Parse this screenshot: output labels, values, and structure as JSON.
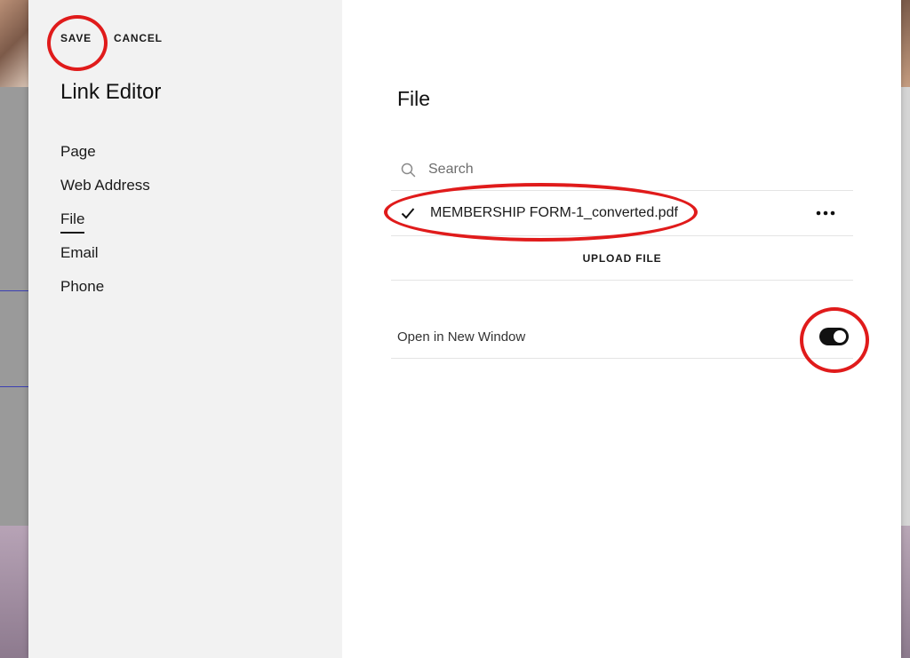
{
  "header": {
    "save_label": "SAVE",
    "cancel_label": "CANCEL",
    "title": "Link Editor"
  },
  "sidebar": {
    "items": [
      {
        "label": "Page"
      },
      {
        "label": "Web Address"
      },
      {
        "label": "File"
      },
      {
        "label": "Email"
      },
      {
        "label": "Phone"
      }
    ],
    "active": "File"
  },
  "main": {
    "title": "File",
    "search": {
      "placeholder": "Search",
      "icon": "search-icon"
    },
    "files": [
      {
        "name": "MEMBERSHIP FORM-1_converted.pdf",
        "selected": true,
        "icon": "check-icon",
        "menu_icon": "more-horizontal-icon"
      }
    ],
    "upload_label": "UPLOAD FILE",
    "open_new_window": {
      "label": "Open in New Window",
      "enabled": true
    }
  },
  "colors": {
    "sidebar_bg": "#f2f2f2",
    "annotation": "#e01b1b",
    "toggle_on": "#111111"
  }
}
